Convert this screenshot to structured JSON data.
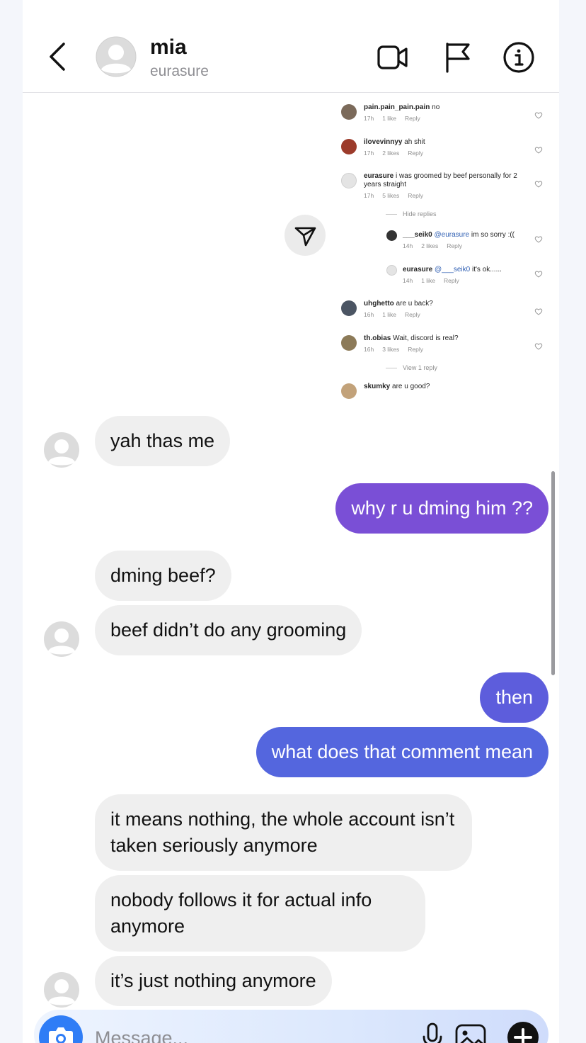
{
  "header": {
    "name": "mia",
    "username": "eurasure"
  },
  "shared_post": {
    "comments": [
      {
        "user": "pain.pain_pain.pain",
        "text": "no",
        "time": "17h",
        "likes": "1 like",
        "reply": "Reply"
      },
      {
        "user": "ilovevinnyy",
        "text": "ah shit",
        "time": "17h",
        "likes": "2 likes",
        "reply": "Reply"
      },
      {
        "user": "eurasure",
        "text": "i was groomed by beef personally for 2 years straight",
        "time": "17h",
        "likes": "5 likes",
        "reply": "Reply"
      },
      {
        "user": "___seik0",
        "mention": "@eurasure",
        "text": "im so sorry :((",
        "time": "14h",
        "likes": "2 likes",
        "reply": "Reply"
      },
      {
        "user": "eurasure",
        "mention": "@___seik0",
        "text": "it's ok......",
        "time": "14h",
        "likes": "1 like",
        "reply": "Reply"
      },
      {
        "user": "uhghetto",
        "text": "are u back?",
        "time": "16h",
        "likes": "1 like",
        "reply": "Reply"
      },
      {
        "user": "th.obias",
        "text": "Wait, discord is real?",
        "time": "16h",
        "likes": "3 likes",
        "reply": "Reply"
      },
      {
        "user": "skumky",
        "text": "are u good?"
      }
    ],
    "hide_replies": "Hide replies",
    "view_reply": "View 1 reply"
  },
  "messages": [
    {
      "from": "them",
      "text": "yah thas me"
    },
    {
      "from": "me",
      "text": "why r u dming him ??",
      "color": "#7a4fd6"
    },
    {
      "from": "them",
      "text": "dming beef?"
    },
    {
      "from": "them",
      "text": "beef didn’t do any grooming"
    },
    {
      "from": "me",
      "text": "then",
      "color": "#5d5ddc"
    },
    {
      "from": "me",
      "text": "what does that comment mean",
      "color": "#5466de"
    },
    {
      "from": "them",
      "text": "it means nothing, the whole account isn’t taken seriously anymore"
    },
    {
      "from": "them",
      "text": "nobody follows it for actual info anymore"
    },
    {
      "from": "them",
      "text": "it’s just nothing anymore"
    }
  ],
  "composer": {
    "placeholder": "Message..."
  },
  "icons": {
    "back": "chevron-left-icon",
    "video": "video-call-icon",
    "flag": "flag-icon",
    "info": "info-icon",
    "forward": "send-icon",
    "camera": "camera-icon",
    "mic": "microphone-icon",
    "gallery": "gallery-icon",
    "add": "plus-icon"
  }
}
